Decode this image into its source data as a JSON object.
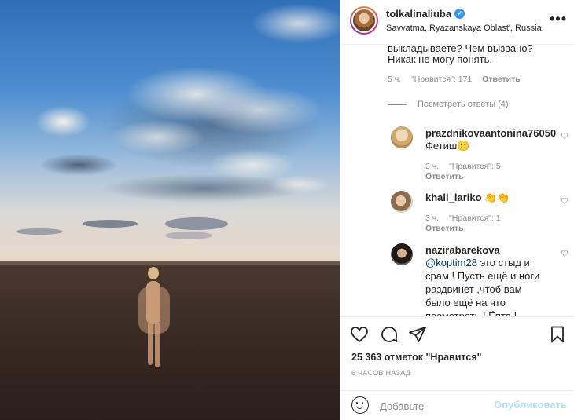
{
  "post": {
    "username": "tolkalinaliuba",
    "location": "Savvatma, Ryazanskaya Oblast', Russia",
    "likes": "25 363 отметок \"Нравится\"",
    "time_ago": "6 ЧАСОВ НАЗАД"
  },
  "comments": {
    "first": {
      "text_line1": "выкладываете? Чем вызвано?",
      "text_line2": "Никак не могу понять.",
      "time": "5 ч.",
      "likes": "\"Нравится\": 171",
      "reply": "Ответить"
    },
    "view_replies": "Посмотреть ответы (4)",
    "items": [
      {
        "user": "prazdnikovaantonina76050",
        "text": "Фетиш🙂",
        "time": "3 ч.",
        "likes": "\"Нравится\": 5",
        "reply": "Ответить"
      },
      {
        "user": "khali_lariko",
        "text": "👏👏",
        "time": "3 ч.",
        "likes": "\"Нравится\": 1",
        "reply": "Ответить"
      },
      {
        "user": "nazirabarekova",
        "mention": "@koptim28",
        "text_line1": " это стыд и",
        "text_line2": "срам ! Пусть ещё и ноги",
        "text_line3": "раздвинет ,чтоб вам",
        "text_line4": "было ещё на что",
        "text_line5": "посмотреть ! Ёпта !"
      }
    ]
  },
  "add_comment": {
    "placeholder": "Добавьте",
    "publish": "Опубликовать"
  },
  "icons": {
    "more": "more-options-icon",
    "like": "heart-icon",
    "comment": "comment-bubble-icon",
    "share": "paper-plane-icon",
    "save": "bookmark-icon",
    "emoji": "emoji-icon"
  },
  "colors": {
    "verified": "#3897f0",
    "publish_disabled": "#b2dffc",
    "mention": "#00376b",
    "meta": "#8e8e8e"
  }
}
